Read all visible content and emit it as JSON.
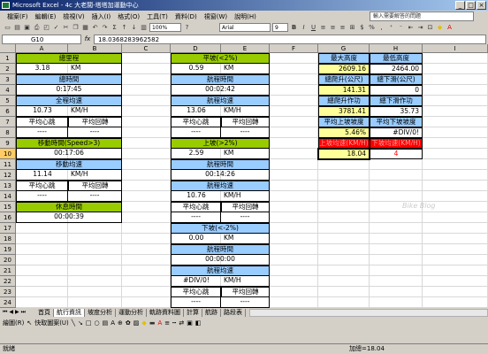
{
  "window": {
    "title": "Microsoft Excel - 4c 大老闆-塔塔加運動中心",
    "minimize": "_",
    "restore": "□",
    "close": "×"
  },
  "menu": [
    "檔案(F)",
    "編輯(E)",
    "檢視(V)",
    "插入(I)",
    "格式(O)",
    "工具(T)",
    "資料(D)",
    "視窗(W)",
    "說明(H)"
  ],
  "help_placeholder": "輸入需要解答的問題",
  "toolbar": {
    "zoom": "100%",
    "font": "Arial",
    "size": "9"
  },
  "formula_bar": {
    "name_box": "G10",
    "fx": "fx",
    "value": "18.0368283962582"
  },
  "columns": [
    "A",
    "B",
    "C",
    "D",
    "E",
    "F",
    "G",
    "H",
    "I"
  ],
  "rows": [
    "1",
    "2",
    "3",
    "4",
    "5",
    "6",
    "7",
    "8",
    "9",
    "10",
    "11",
    "12",
    "13",
    "14",
    "15",
    "16",
    "17",
    "18",
    "19",
    "20",
    "21",
    "22",
    "23",
    "24"
  ],
  "cells": {
    "A1": "總里程",
    "A2": "3.18",
    "B2": "KM",
    "A3": "總時間",
    "A4": "0:17:45",
    "A5": "全程均速",
    "A6": "10.73",
    "B6": "KM/H",
    "A7": "平均心跳",
    "B7": "平均回轉",
    "A8": "----",
    "B8": "----",
    "A9": "移動時間(Speed>3)",
    "A10": "00:17:06",
    "A11": "移動均速",
    "A12": "11.14",
    "B12": "KM/H",
    "A13": "平均心跳",
    "B13": "平均回轉",
    "A14": "----",
    "B14": "----",
    "A15": "休息時間",
    "A16": "00:00:39",
    "D1": "平坡(<2%)",
    "D2": "0.59",
    "E2": "KM",
    "D3": "航程時間",
    "D4": "00:02:42",
    "D5": "航程均速",
    "D6": "13.06",
    "E6": "KM/H",
    "D7": "平均心跳",
    "E7": "平均回轉",
    "D8": "----",
    "E8": "----",
    "D9": "上坡(>2%)",
    "D10": "2.59",
    "E10": "KM",
    "D11": "航程時間",
    "D12": "00:14:26",
    "D13": "航程均速",
    "D14": "10.76",
    "E14": "KM/H",
    "D15": "平均心跳",
    "E15": "平均回轉",
    "D16": "----",
    "E16": "----",
    "D17": "下坡(<-2%)",
    "D18": "0.00",
    "E18": "KM",
    "D19": "航程時間",
    "D20": "00:00:00",
    "D21": "航程均速",
    "D22": "#DIV/0!",
    "E22": "KM/H",
    "D23": "平均心跳",
    "E23": "平均回轉",
    "D24": "----",
    "E24": "----",
    "G1": "最大高度",
    "H1": "最低高度",
    "G2": "2609.16",
    "H2": "2464.00",
    "G3": "總爬升(公尺)",
    "H3": "總下滑(公尺)",
    "G4": "141.31",
    "H4": "0",
    "G5": "總爬升作功",
    "H5": "總下滑作功",
    "G6": "3781.41",
    "H6": "35.73",
    "G7": "平均上坡坡度",
    "H7": "平均下坡坡度",
    "G8": "5.46%",
    "H8": "#DIV/0!",
    "G9": "上坡均速(KM/H)",
    "H9": "下坡均速(KM/H)",
    "G10": "18.04",
    "H10": "4"
  },
  "sheet_tabs": [
    "首頁",
    "航行資訊",
    "坡度分析",
    "運動分析",
    "軌跡資料圖",
    "計算",
    "航跡",
    "路段表"
  ],
  "active_tab": "航行資訊",
  "drawbar": {
    "draw": "繪圖(R)",
    "autoshape": "快取圖案(U)"
  },
  "status": {
    "ready": "就緒",
    "sum": "加總=18.04"
  },
  "watermark": "Bike Blog",
  "colors": {
    "green": "#99cc00",
    "blue": "#99ccff",
    "red": "#ff0000",
    "yellow": "#ffff99"
  }
}
